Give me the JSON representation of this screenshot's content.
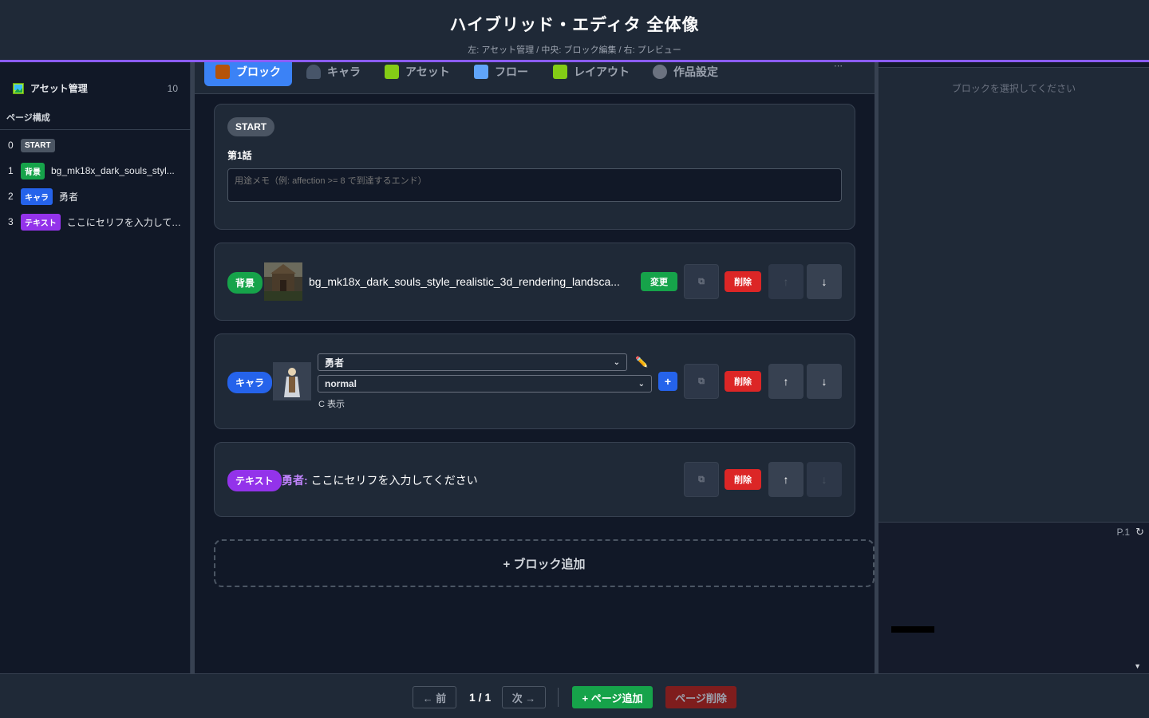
{
  "header": {
    "title": "ハイブリッド・エディタ 全体像",
    "subtitle": "左: アセット管理 / 中央: ブロック編集 / 右: プレビュー"
  },
  "sidebar": {
    "asset_item": {
      "label": "アセット管理",
      "count": "10",
      "icon": "picture-icon"
    },
    "section_title": "ページ構成",
    "pages": [
      {
        "index": "0",
        "tag": "START",
        "text": ""
      },
      {
        "index": "1",
        "tag": "背景",
        "text": "bg_mk18x_dark_souls_styl..."
      },
      {
        "index": "2",
        "tag": "キャラ",
        "text": "勇者"
      },
      {
        "index": "3",
        "tag": "テキスト",
        "text": "ここにセリフを入力してく..."
      }
    ]
  },
  "tabs": [
    {
      "label": "ブロック",
      "icon": "brick-icon",
      "active": true
    },
    {
      "label": "キャラ",
      "icon": "person-icon",
      "active": false
    },
    {
      "label": "アセット",
      "icon": "picture-icon",
      "active": false
    },
    {
      "label": "フロー",
      "icon": "shuffle-icon",
      "active": false
    },
    {
      "label": "レイアウト",
      "icon": "picture-icon",
      "active": false
    },
    {
      "label": "作品設定",
      "icon": "gear-icon",
      "active": false
    }
  ],
  "start_block": {
    "pill": "START",
    "title": "第1話",
    "memo_placeholder": "用途メモ（例: affection >= 8 で到達するエンド）"
  },
  "bg_block": {
    "tag": "背景",
    "filename": "bg_mk18x_dark_souls_style_realistic_3d_rendering_landsca...",
    "change_label": "変更",
    "copy_label": "⧉",
    "delete_label": "削除",
    "up_label": "↑",
    "down_label": "↓"
  },
  "chara_block": {
    "tag": "キャラ",
    "character": "勇者",
    "expression": "normal",
    "add_label": "+",
    "position_note": "C 表示",
    "copy_label": "⧉",
    "delete_label": "削除",
    "up_label": "↑",
    "down_label": "↓"
  },
  "text_block": {
    "tag": "テキスト",
    "speaker": "勇者:",
    "line": "ここにセリフを入力してください",
    "copy_label": "⧉",
    "delete_label": "削除",
    "up_label": "↑",
    "down_label": "↓"
  },
  "add_block_label": "+ ブロック追加",
  "inspector": {
    "empty_message": "ブロックを選択してください"
  },
  "preview": {
    "page_label": "P.1",
    "reload_icon": "↻",
    "scroll_icon": "▼"
  },
  "footer": {
    "prev_label": "← 前",
    "page_indicator": "1 / 1",
    "next_label": "次 →",
    "add_page_label": "+ ページ追加",
    "delete_page_label": "ページ削除"
  },
  "colors": {
    "accent": "#3b82f6",
    "bg_tag": "#16a34a",
    "chara_tag": "#2563eb",
    "text_tag": "#9333ea",
    "delete": "#dc2626",
    "header_border": "#8b5cf6"
  }
}
